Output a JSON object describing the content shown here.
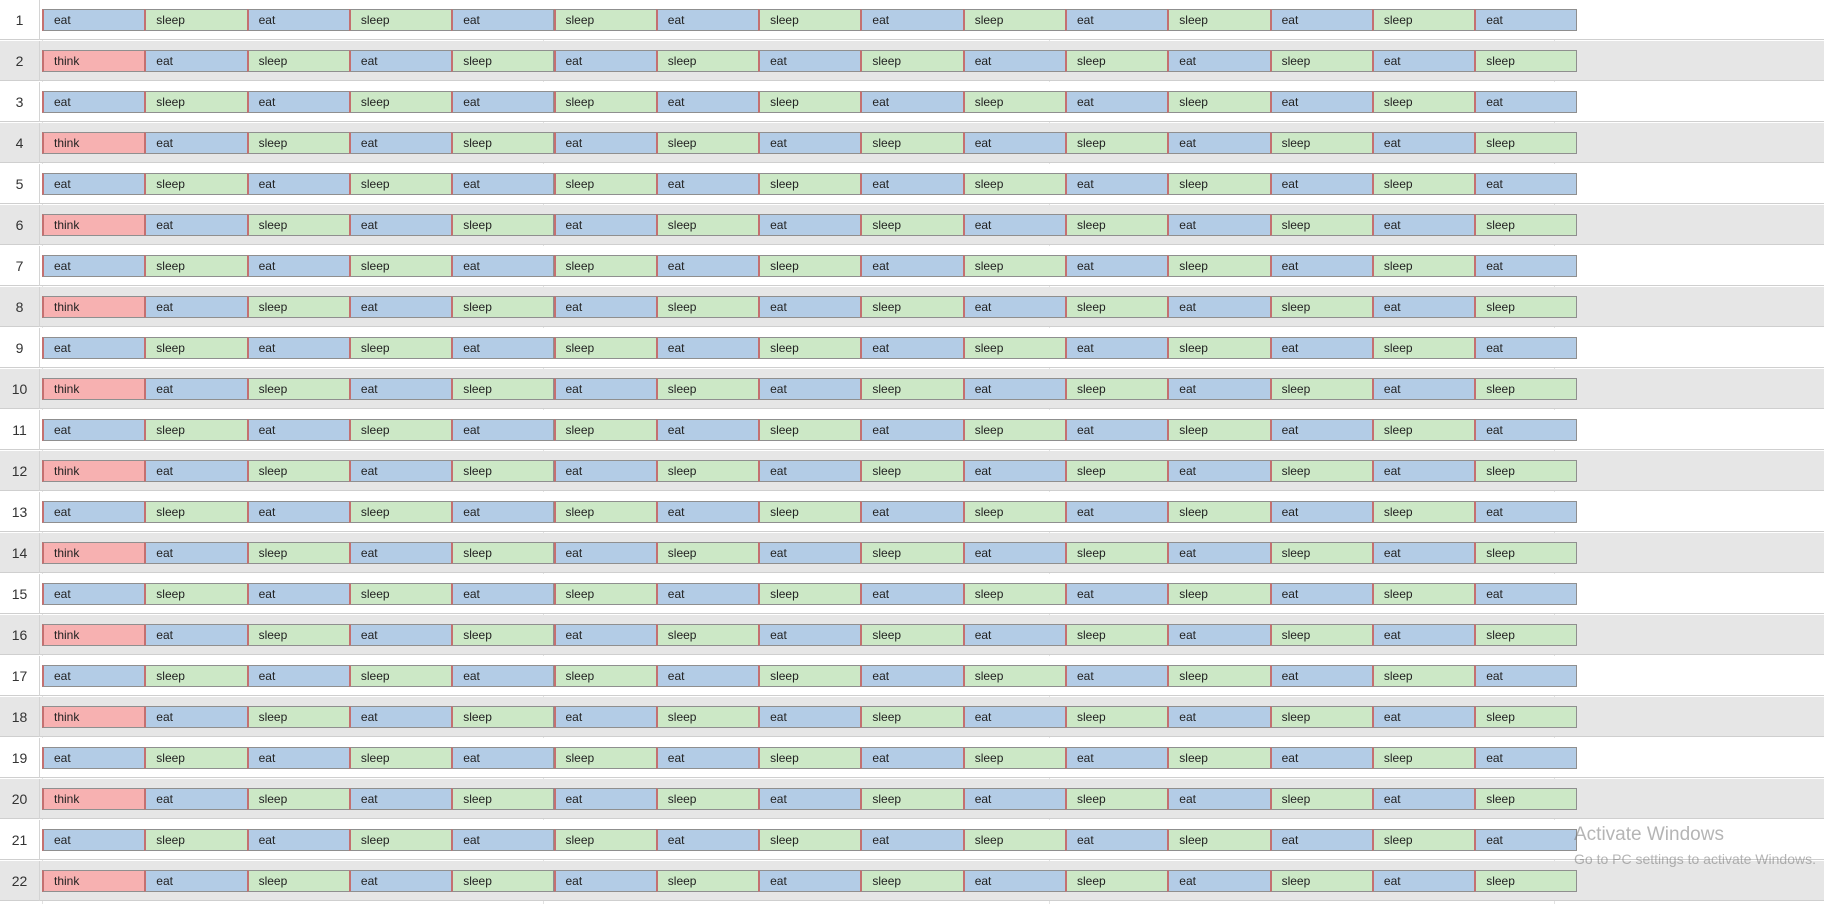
{
  "labels": {
    "think": "think",
    "eat": "eat",
    "sleep": "sleep"
  },
  "colors": {
    "think": "#f7b1b1",
    "eat": "#b3cce6",
    "sleep": "#cce8c6",
    "row_odd": "#ffffff",
    "row_even": "#e6e6e6"
  },
  "rows": [
    {
      "number": "1",
      "start_state": "eat"
    },
    {
      "number": "2",
      "start_state": "think"
    },
    {
      "number": "3",
      "start_state": "eat"
    },
    {
      "number": "4",
      "start_state": "think"
    },
    {
      "number": "5",
      "start_state": "eat"
    },
    {
      "number": "6",
      "start_state": "think"
    },
    {
      "number": "7",
      "start_state": "eat"
    },
    {
      "number": "8",
      "start_state": "think"
    },
    {
      "number": "9",
      "start_state": "eat"
    },
    {
      "number": "10",
      "start_state": "think"
    },
    {
      "number": "11",
      "start_state": "eat"
    },
    {
      "number": "12",
      "start_state": "think"
    },
    {
      "number": "13",
      "start_state": "eat"
    },
    {
      "number": "14",
      "start_state": "think"
    },
    {
      "number": "15",
      "start_state": "eat"
    },
    {
      "number": "16",
      "start_state": "think"
    },
    {
      "number": "17",
      "start_state": "eat"
    },
    {
      "number": "18",
      "start_state": "think"
    },
    {
      "number": "19",
      "start_state": "eat"
    },
    {
      "number": "20",
      "start_state": "think"
    },
    {
      "number": "21",
      "start_state": "eat"
    },
    {
      "number": "22",
      "start_state": "think"
    }
  ],
  "watermark": {
    "title": "Activate Windows",
    "subtitle": "Go to PC settings to activate Windows."
  }
}
